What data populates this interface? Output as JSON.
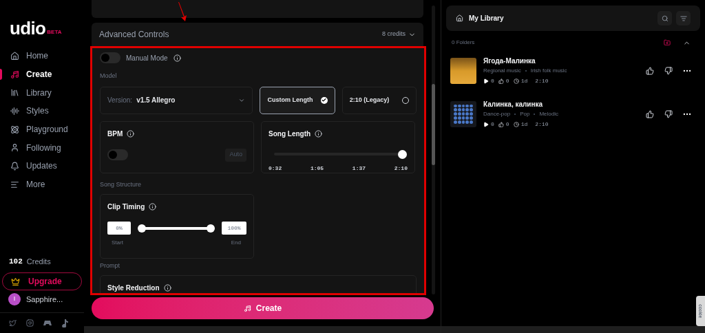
{
  "sidebar": {
    "logo": {
      "text": "udio",
      "badge": "BETA"
    },
    "nav": [
      {
        "label": "Home",
        "selected": false
      },
      {
        "label": "Create",
        "selected": true
      },
      {
        "label": "Library",
        "selected": false
      },
      {
        "label": "Styles",
        "selected": false
      },
      {
        "label": "Playground",
        "selected": false
      },
      {
        "label": "Following",
        "selected": false
      },
      {
        "label": "Updates",
        "selected": false
      },
      {
        "label": "More",
        "selected": false
      }
    ],
    "credits": {
      "count": "102",
      "label": "Credits"
    },
    "upgrade": "Upgrade",
    "user": {
      "initial": "I",
      "name": "Sapphire..."
    }
  },
  "advanced": {
    "title": "Advanced Controls",
    "cost": "8 credits",
    "manual_mode": {
      "label": "Manual Mode",
      "on": false
    },
    "model_label": "Model",
    "version": {
      "label": "Version:",
      "value": "v1.5 Allegro"
    },
    "length_options": [
      {
        "label": "Custom Length",
        "selected": true
      },
      {
        "label": "2:10 (Legacy)",
        "selected": false
      }
    ],
    "bpm": {
      "title": "BPM",
      "on": false,
      "button": "Auto"
    },
    "song_length": {
      "title": "Song Length",
      "level": 1,
      "ticks": [
        "0:32",
        "1:05",
        "1:37",
        "2:10"
      ]
    },
    "structure_label": "Song Structure",
    "clip_timing": {
      "title": "Clip Timing",
      "start_value": "0%",
      "end_value": "100%",
      "start_label": "Start",
      "end_label": "End",
      "start_thumb": {
        "level": 0
      },
      "end_thumb": {
        "level": 1
      }
    },
    "prompt_label": "Prompt",
    "style_reduction": {
      "title": "Style Reduction"
    }
  },
  "create_button": "Create",
  "library": {
    "title": "My Library",
    "folders": "0 Folders",
    "songs": [
      {
        "title": "Ягода-Малинка",
        "tags": [
          "Regional music",
          "Irish folk music"
        ],
        "plays": "0",
        "likes": "0",
        "age": "1d",
        "duration": "2:10"
      },
      {
        "title": "Калинка, калинка",
        "tags": [
          "Dance-pop",
          "Pop",
          "Melodic"
        ],
        "plays": "0",
        "likes": "0",
        "age": "1d",
        "duration": "2:10"
      }
    ]
  },
  "cookie_tab": "cookie"
}
